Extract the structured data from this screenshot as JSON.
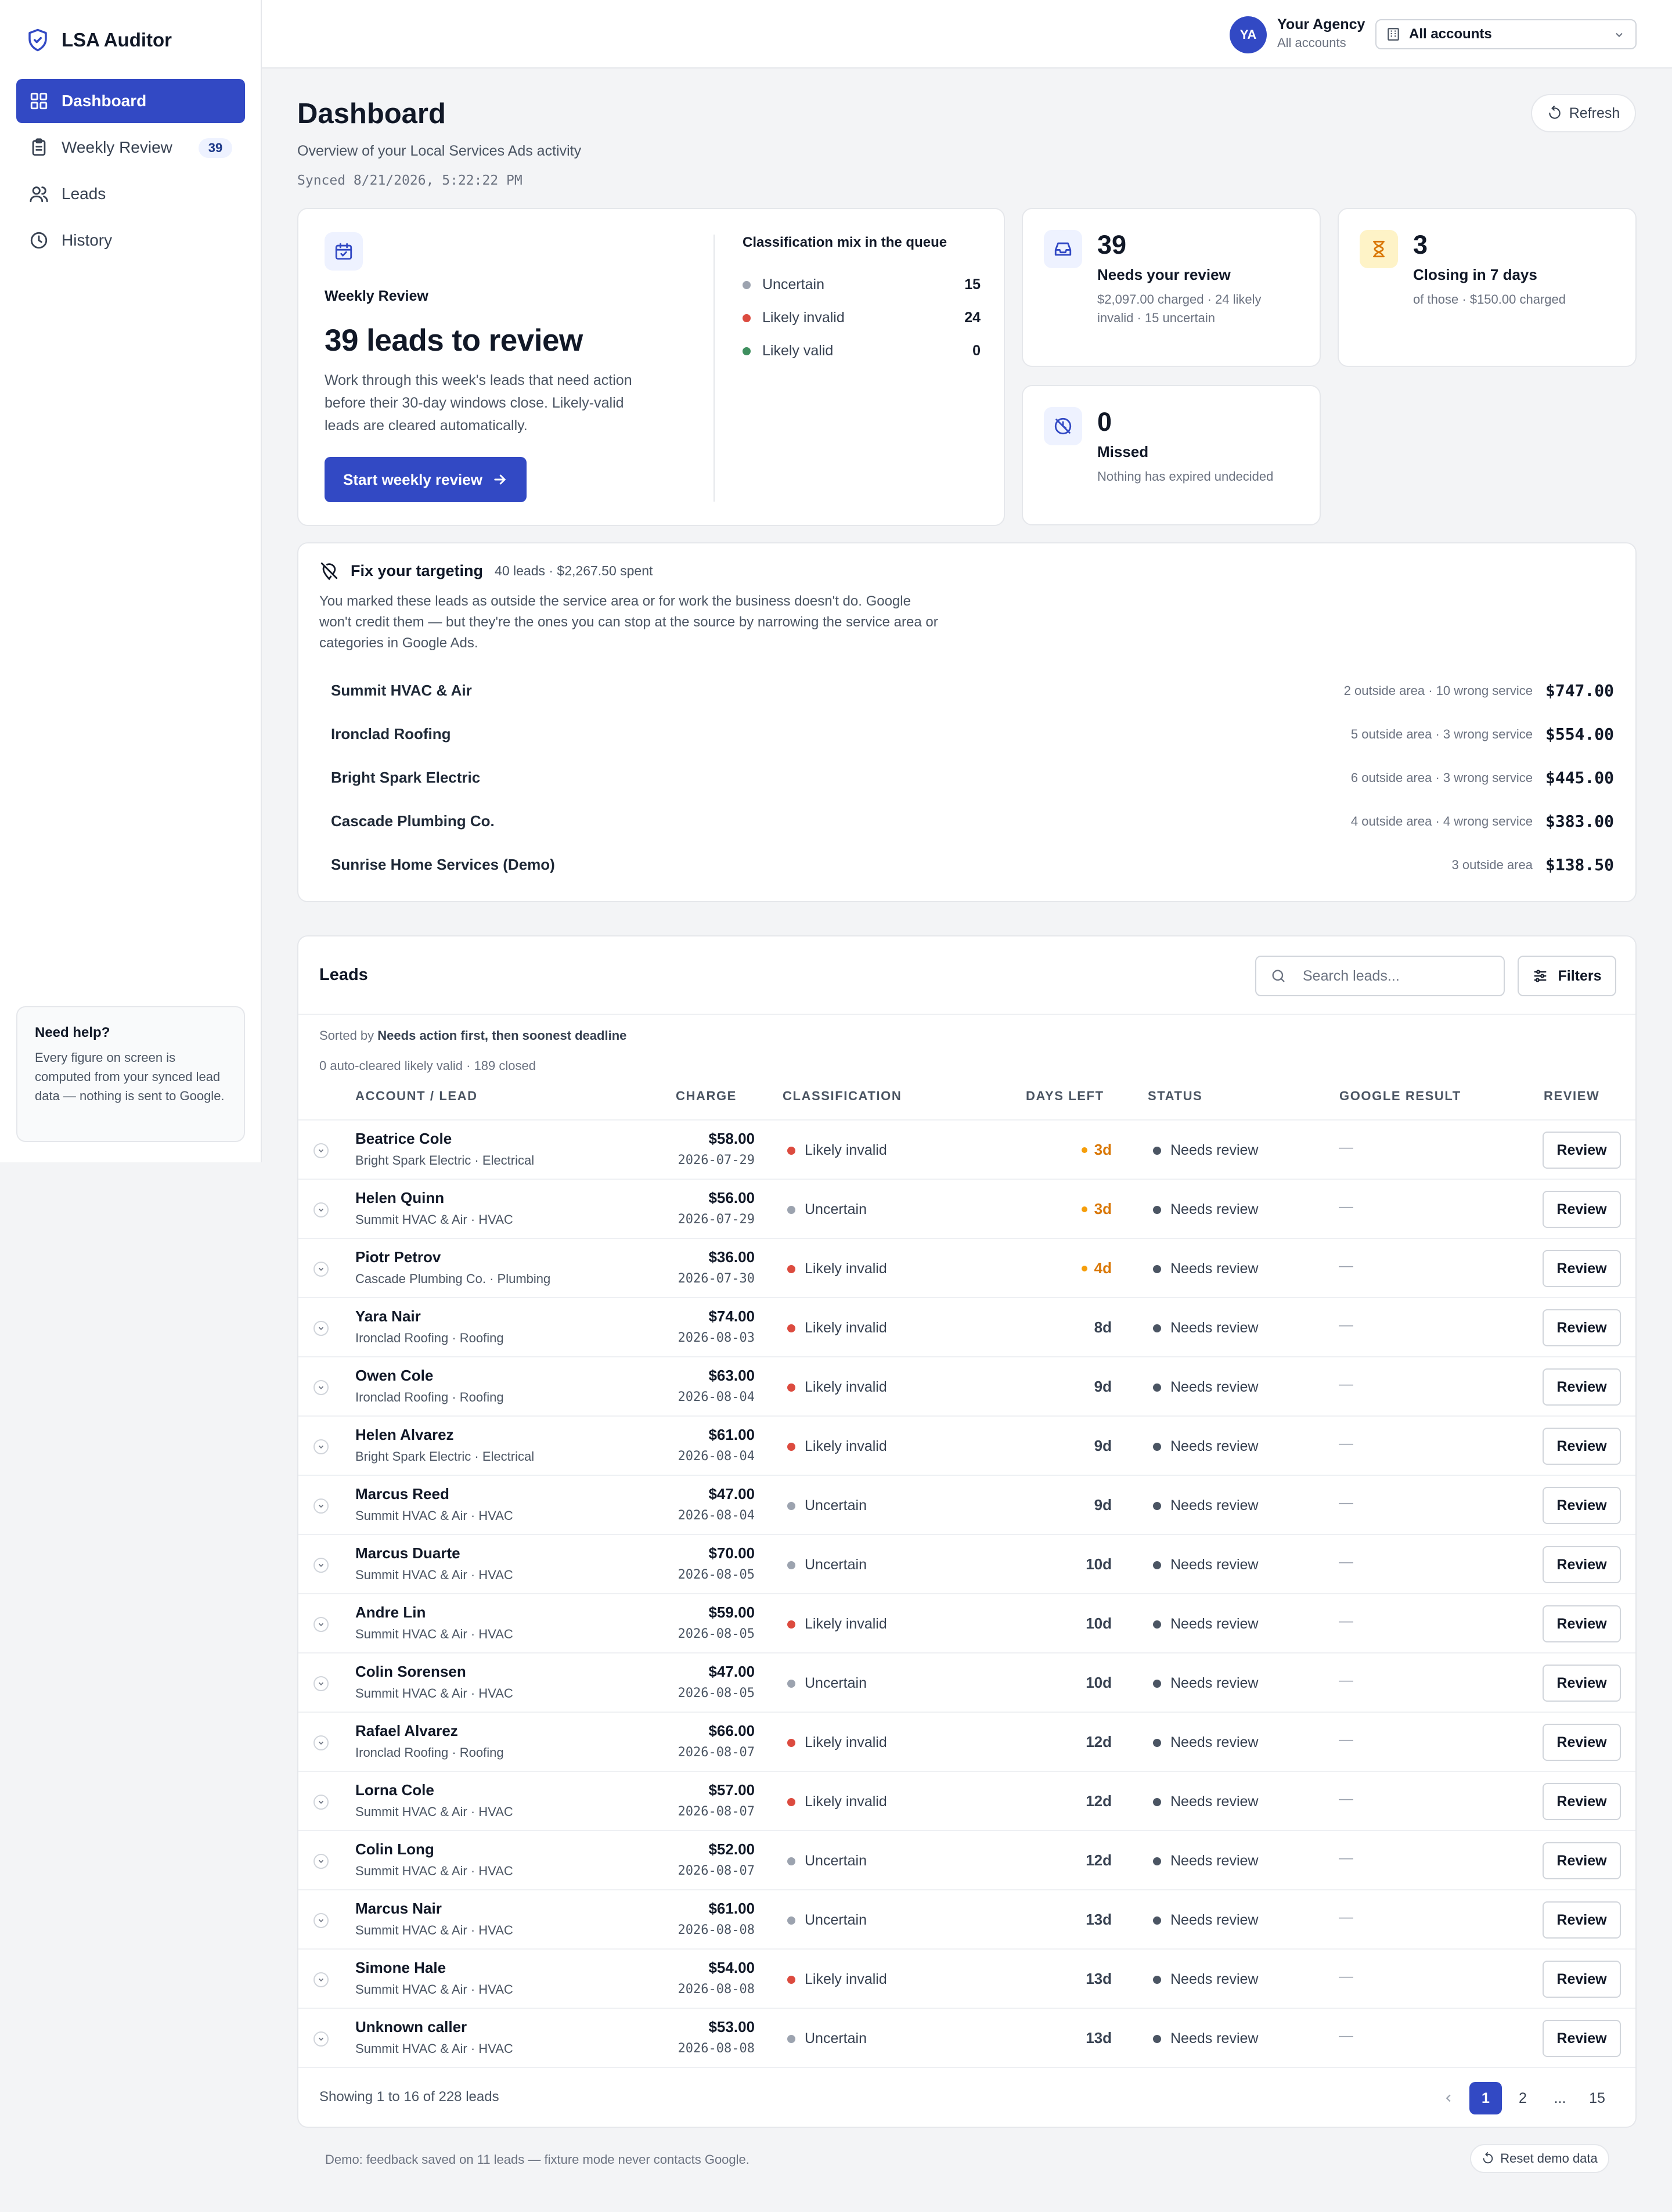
{
  "app": {
    "name": "LSA Auditor"
  },
  "sidebar": {
    "items": [
      {
        "label": "Dashboard",
        "icon": "grid-icon",
        "active": true
      },
      {
        "label": "Weekly Review",
        "icon": "clipboard-icon",
        "badge": "39"
      },
      {
        "label": "Leads",
        "icon": "users-icon"
      },
      {
        "label": "History",
        "icon": "clock-icon"
      }
    ],
    "help": {
      "title": "Need help?",
      "body": "Every figure on screen is computed from your synced lead data — nothing is sent to Google."
    }
  },
  "topbar": {
    "avatar_initials": "YA",
    "agency_name": "Your Agency",
    "agency_sub": "All accounts",
    "account_select": "All accounts"
  },
  "page": {
    "title": "Dashboard",
    "subtitle": "Overview of your Local Services Ads activity",
    "synced": "Synced 8/21/2026, 5:22:22 PM",
    "refresh_label": "Refresh"
  },
  "weekly_review": {
    "kicker": "Weekly Review",
    "headline": "39 leads to review",
    "body": "Work through this week's leads that need action before their 30-day windows close. Likely-valid leads are cleared automatically.",
    "cta": "Start weekly review",
    "mix_title": "Classification mix in the queue",
    "mix": [
      {
        "label": "Uncertain",
        "value": "15",
        "color": "#9ca3af"
      },
      {
        "label": "Likely invalid",
        "value": "24",
        "color": "#dc4b3f"
      },
      {
        "label": "Likely valid",
        "value": "0",
        "color": "#3f8f5f"
      }
    ]
  },
  "stats": {
    "needs_review": {
      "value": "39",
      "label": "Needs your review",
      "sub": "$2,097.00 charged · 24 likely invalid · 15 uncertain"
    },
    "closing": {
      "value": "3",
      "label": "Closing in 7 days",
      "sub": "of those · $150.00 charged"
    },
    "missed": {
      "value": "0",
      "label": "Missed",
      "sub": "Nothing has expired undecided"
    }
  },
  "targeting": {
    "title": "Fix your targeting",
    "meta": "40 leads · $2,267.50 spent",
    "desc": "You marked these leads as outside the service area or for work the business doesn't do. Google won't credit them — but they're the ones you can stop at the source by narrowing the service area or categories in Google Ads.",
    "rows": [
      {
        "name": "Summit HVAC & Air",
        "detail": "2 outside area · 10 wrong service",
        "amount": "$747.00"
      },
      {
        "name": "Ironclad Roofing",
        "detail": "5 outside area · 3 wrong service",
        "amount": "$554.00"
      },
      {
        "name": "Bright Spark Electric",
        "detail": "6 outside area · 3 wrong service",
        "amount": "$445.00"
      },
      {
        "name": "Cascade Plumbing Co.",
        "detail": "4 outside area · 4 wrong service",
        "amount": "$383.00"
      },
      {
        "name": "Sunrise Home Services (Demo)",
        "detail": "3 outside area",
        "amount": "$138.50"
      }
    ]
  },
  "leads": {
    "title": "Leads",
    "search_placeholder": "Search leads...",
    "filters_label": "Filters",
    "sorted_prefix": "Sorted by",
    "sorted_by": "Needs action first, then soonest deadline",
    "auto_line": "0 auto-cleared likely valid · 189 closed",
    "columns": {
      "account": "ACCOUNT / LEAD",
      "charge": "CHARGE",
      "classification": "CLASSIFICATION",
      "days": "DAYS LEFT",
      "status": "STATUS",
      "google": "GOOGLE RESULT",
      "review": "REVIEW"
    },
    "review_label": "Review",
    "rows": [
      {
        "name": "Beatrice Cole",
        "account": "Bright Spark Electric · Electrical",
        "charge": "$58.00",
        "date": "2026-07-29",
        "class": "Likely invalid",
        "days": "3d",
        "warn": true,
        "status": "Needs review",
        "google": "—"
      },
      {
        "name": "Helen Quinn",
        "account": "Summit HVAC & Air · HVAC",
        "charge": "$56.00",
        "date": "2026-07-29",
        "class": "Uncertain",
        "days": "3d",
        "warn": true,
        "status": "Needs review",
        "google": "—"
      },
      {
        "name": "Piotr Petrov",
        "account": "Cascade Plumbing Co. · Plumbing",
        "charge": "$36.00",
        "date": "2026-07-30",
        "class": "Likely invalid",
        "days": "4d",
        "warn": true,
        "status": "Needs review",
        "google": "—"
      },
      {
        "name": "Yara Nair",
        "account": "Ironclad Roofing · Roofing",
        "charge": "$74.00",
        "date": "2026-08-03",
        "class": "Likely invalid",
        "days": "8d",
        "warn": false,
        "status": "Needs review",
        "google": "—"
      },
      {
        "name": "Owen Cole",
        "account": "Ironclad Roofing · Roofing",
        "charge": "$63.00",
        "date": "2026-08-04",
        "class": "Likely invalid",
        "days": "9d",
        "warn": false,
        "status": "Needs review",
        "google": "—"
      },
      {
        "name": "Helen Alvarez",
        "account": "Bright Spark Electric · Electrical",
        "charge": "$61.00",
        "date": "2026-08-04",
        "class": "Likely invalid",
        "days": "9d",
        "warn": false,
        "status": "Needs review",
        "google": "—"
      },
      {
        "name": "Marcus Reed",
        "account": "Summit HVAC & Air · HVAC",
        "charge": "$47.00",
        "date": "2026-08-04",
        "class": "Uncertain",
        "days": "9d",
        "warn": false,
        "status": "Needs review",
        "google": "—"
      },
      {
        "name": "Marcus Duarte",
        "account": "Summit HVAC & Air · HVAC",
        "charge": "$70.00",
        "date": "2026-08-05",
        "class": "Uncertain",
        "days": "10d",
        "warn": false,
        "status": "Needs review",
        "google": "—"
      },
      {
        "name": "Andre Lin",
        "account": "Summit HVAC & Air · HVAC",
        "charge": "$59.00",
        "date": "2026-08-05",
        "class": "Likely invalid",
        "days": "10d",
        "warn": false,
        "status": "Needs review",
        "google": "—"
      },
      {
        "name": "Colin Sorensen",
        "account": "Summit HVAC & Air · HVAC",
        "charge": "$47.00",
        "date": "2026-08-05",
        "class": "Uncertain",
        "days": "10d",
        "warn": false,
        "status": "Needs review",
        "google": "—"
      },
      {
        "name": "Rafael Alvarez",
        "account": "Ironclad Roofing · Roofing",
        "charge": "$66.00",
        "date": "2026-08-07",
        "class": "Likely invalid",
        "days": "12d",
        "warn": false,
        "status": "Needs review",
        "google": "—"
      },
      {
        "name": "Lorna Cole",
        "account": "Summit HVAC & Air · HVAC",
        "charge": "$57.00",
        "date": "2026-08-07",
        "class": "Likely invalid",
        "days": "12d",
        "warn": false,
        "status": "Needs review",
        "google": "—"
      },
      {
        "name": "Colin Long",
        "account": "Summit HVAC & Air · HVAC",
        "charge": "$52.00",
        "date": "2026-08-07",
        "class": "Uncertain",
        "days": "12d",
        "warn": false,
        "status": "Needs review",
        "google": "—"
      },
      {
        "name": "Marcus Nair",
        "account": "Summit HVAC & Air · HVAC",
        "charge": "$61.00",
        "date": "2026-08-08",
        "class": "Uncertain",
        "days": "13d",
        "warn": false,
        "status": "Needs review",
        "google": "—"
      },
      {
        "name": "Simone Hale",
        "account": "Summit HVAC & Air · HVAC",
        "charge": "$54.00",
        "date": "2026-08-08",
        "class": "Likely invalid",
        "days": "13d",
        "warn": false,
        "status": "Needs review",
        "google": "—"
      },
      {
        "name": "Unknown caller",
        "account": "Summit HVAC & Air · HVAC",
        "charge": "$53.00",
        "date": "2026-08-08",
        "class": "Uncertain",
        "days": "13d",
        "warn": false,
        "status": "Needs review",
        "google": "—"
      }
    ],
    "showing": "Showing 1 to 16 of 228 leads",
    "pages": [
      "1",
      "2",
      "...",
      "15"
    ]
  },
  "footer": {
    "note": "Demo: feedback saved on 11 leads — fixture mode never contacts Google.",
    "reset_label": "Reset demo data"
  },
  "colors": {
    "accent": "#3249c4",
    "invalid": "#dc4b3f",
    "uncertain": "#9ca3af",
    "valid": "#3f8f5f",
    "warn": "#d97706",
    "status": "#4b5563"
  }
}
